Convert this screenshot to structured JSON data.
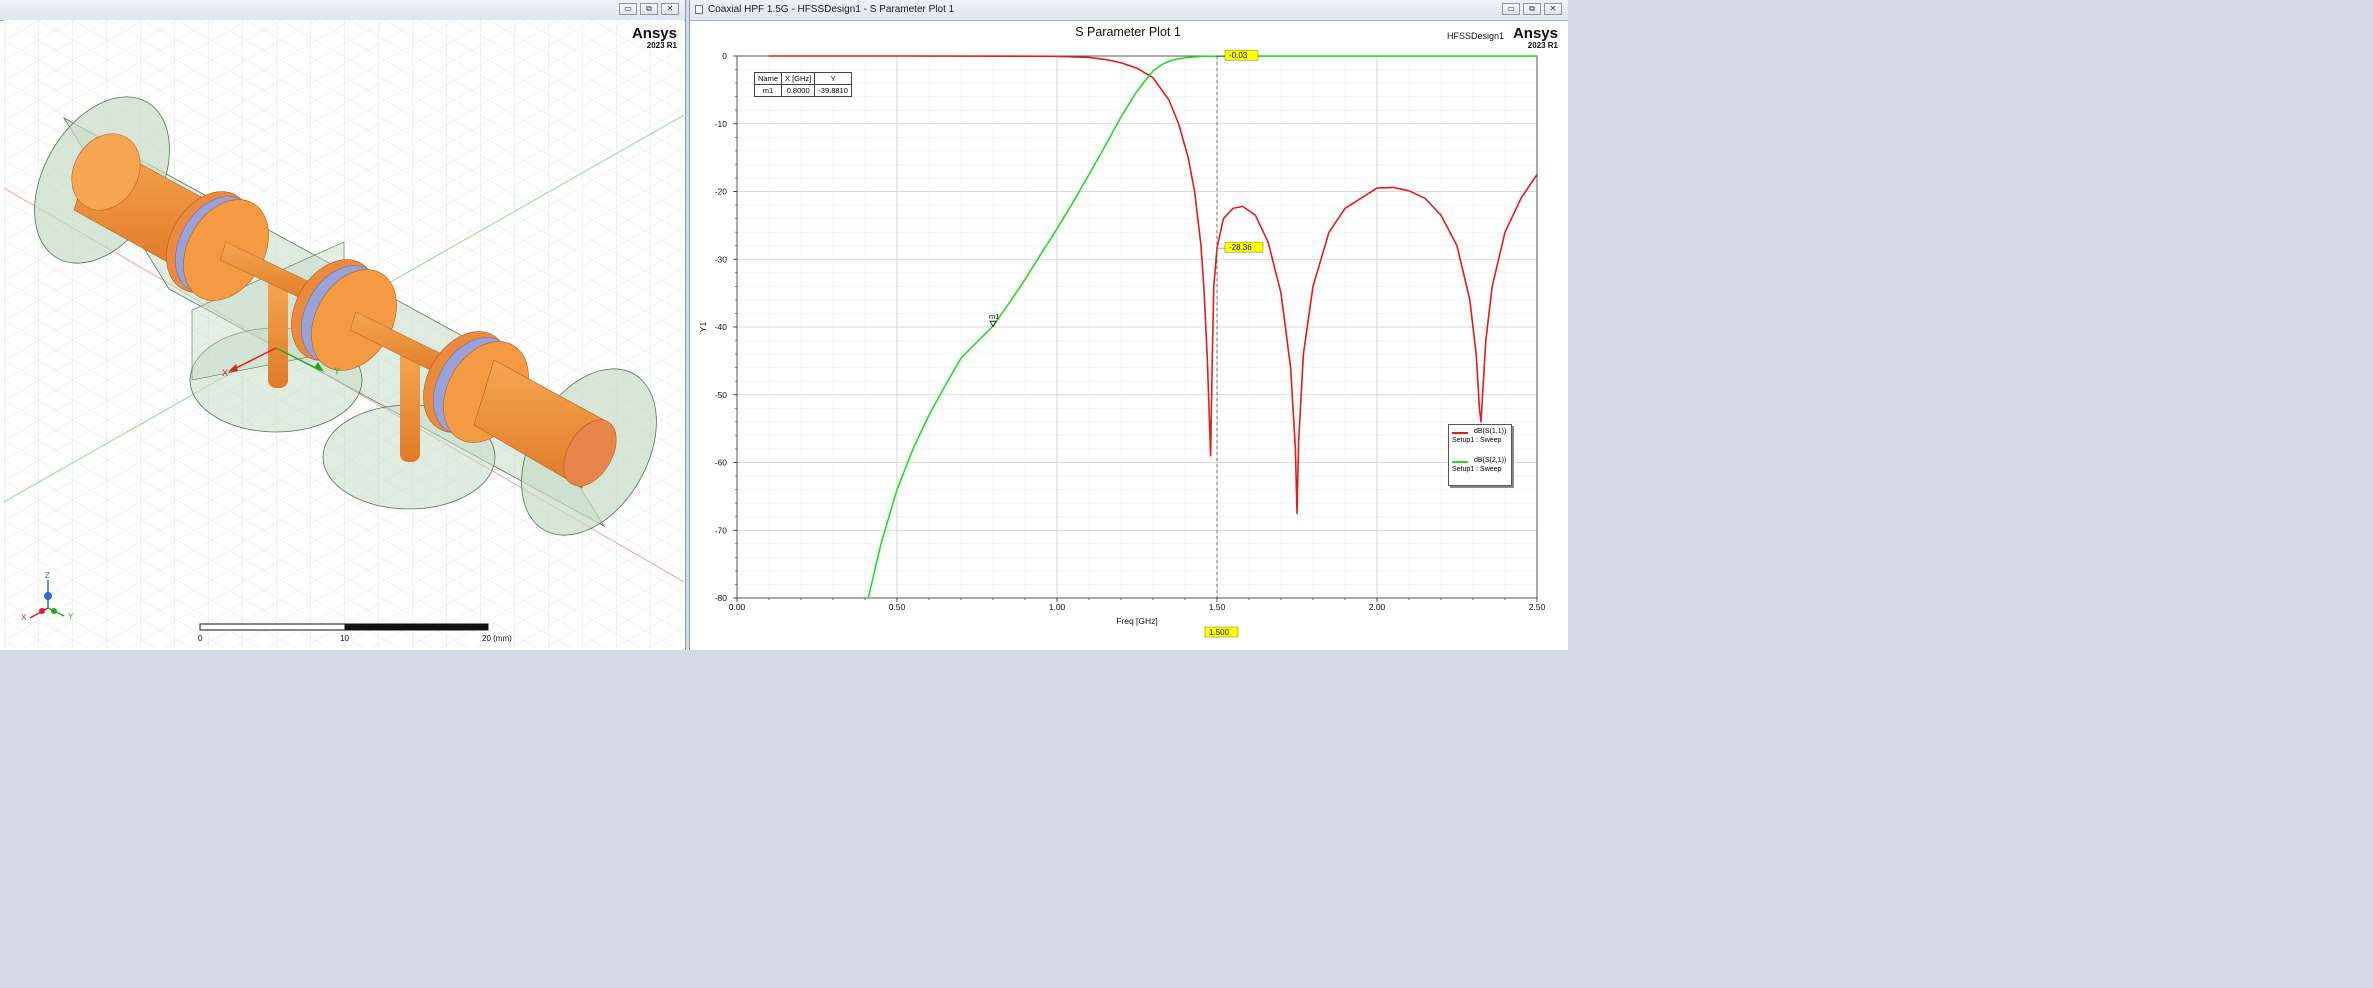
{
  "left_window": {
    "brand": "Ansys",
    "version": "2023 R1",
    "axis_labels": {
      "x": "X",
      "y": "Y",
      "z": "Z"
    },
    "scale_labels": [
      "0",
      "10",
      "20 (mm)"
    ]
  },
  "right_window": {
    "title": "Coaxial HPF 1.5G - HFSSDesign1 - S Parameter Plot 1",
    "design_name": "HFSSDesign1",
    "brand": "Ansys",
    "version": "2023 R1"
  },
  "window_buttons": {
    "minimize": "▭",
    "restore": "⧉",
    "close": "✕"
  },
  "colors": {
    "s11": "#e41b1b",
    "s21": "#22dd22",
    "marker_label_bg": "#ffff00",
    "copper": "#f0923a",
    "ptfe": "#9aa0d8",
    "air": "#c6dcc6"
  },
  "marker_table": {
    "headers": [
      "Name",
      "X [GHz]",
      "Y"
    ],
    "rows": [
      [
        "m1",
        "0.8000",
        "-39.8810"
      ]
    ]
  },
  "markers": {
    "m1_label": "m1",
    "cursor_value_s21": "-0.03",
    "cursor_value_s11": "-28.36",
    "cursor_x_label": "1.500"
  },
  "legend": [
    {
      "trace": "dB(S(1,1))",
      "setup": "Setup1 : Sweep",
      "color": "#e41b1b"
    },
    {
      "trace": "dB(S(2,1))",
      "setup": "Setup1 : Sweep",
      "color": "#22dd22"
    }
  ],
  "chart_data": {
    "type": "line",
    "title": "S Parameter Plot 1",
    "xlabel": "Freq [GHz]",
    "ylabel": "Y1",
    "xlim": [
      0,
      2.5
    ],
    "ylim": [
      -80,
      0
    ],
    "xticks": [
      "0.00",
      "0.50",
      "1.00",
      "1.50",
      "2.00",
      "2.50"
    ],
    "yticks": [
      "0",
      "-10",
      "-20",
      "-30",
      "-40",
      "-50",
      "-60",
      "-70",
      "-80"
    ],
    "grid": true,
    "legend_position": "bottom-right",
    "cursor_x": 1.5,
    "marker_m1": {
      "x": 0.8,
      "y": -39.881
    },
    "series": [
      {
        "name": "dB(S(1,1))",
        "color": "#e41b1b",
        "x": [
          0.1,
          0.5,
          1.0,
          1.1,
          1.15,
          1.2,
          1.25,
          1.3,
          1.35,
          1.38,
          1.41,
          1.43,
          1.45,
          1.46,
          1.47,
          1.475,
          1.48,
          1.485,
          1.49,
          1.5,
          1.52,
          1.55,
          1.58,
          1.62,
          1.66,
          1.7,
          1.73,
          1.745,
          1.75,
          1.755,
          1.77,
          1.8,
          1.85,
          1.9,
          2.0,
          2.05,
          2.1,
          2.15,
          2.2,
          2.25,
          2.29,
          2.31,
          2.32,
          2.325,
          2.33,
          2.34,
          2.36,
          2.4,
          2.45,
          2.5
        ],
        "y": [
          0,
          0,
          -0.05,
          -0.2,
          -0.5,
          -1.0,
          -1.8,
          -3.2,
          -6.5,
          -10,
          -15,
          -20,
          -28,
          -35,
          -45,
          -52,
          -59,
          -45,
          -34,
          -28.36,
          -24,
          -22.5,
          -22.2,
          -23.5,
          -27.5,
          -35,
          -46,
          -58,
          -67.5,
          -57,
          -44,
          -34,
          -26,
          -22.5,
          -19.5,
          -19.4,
          -19.9,
          -21,
          -23.5,
          -28,
          -36,
          -44,
          -52,
          -54,
          -50,
          -42,
          -34,
          -26,
          -21,
          -17.5
        ]
      },
      {
        "name": "dB(S(2,1))",
        "color": "#22dd22",
        "x": [
          0.41,
          0.45,
          0.5,
          0.55,
          0.6,
          0.65,
          0.7,
          0.75,
          0.8,
          0.85,
          0.9,
          0.95,
          1.0,
          1.05,
          1.1,
          1.15,
          1.2,
          1.25,
          1.3,
          1.33,
          1.36,
          1.4,
          1.45,
          1.5,
          1.55,
          2.0,
          2.5
        ],
        "y": [
          -80,
          -72,
          -64,
          -58,
          -53,
          -48.7,
          -44.6,
          -42.2,
          -39.881,
          -36.5,
          -33,
          -29.2,
          -25.5,
          -21.6,
          -17.5,
          -13.3,
          -9,
          -5.2,
          -2.2,
          -1.2,
          -0.6,
          -0.25,
          -0.08,
          -0.03,
          -0.02,
          -0.01,
          -0.01
        ]
      }
    ]
  }
}
